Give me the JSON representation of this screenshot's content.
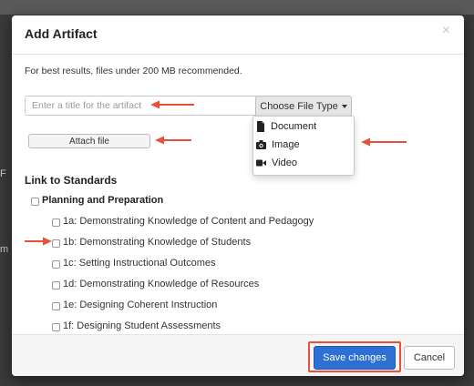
{
  "modal": {
    "title": "Add Artifact",
    "close_glyph": "×",
    "note": "For best results, files under 200 MB recommended."
  },
  "title_input": {
    "value": "",
    "placeholder": "Enter a title for the artifact"
  },
  "file_type": {
    "button_label": "Choose File Type",
    "options": [
      {
        "label": "Document",
        "icon": "document-icon"
      },
      {
        "label": "Image",
        "icon": "camera-icon"
      },
      {
        "label": "Video",
        "icon": "video-camera-icon"
      }
    ]
  },
  "attach": {
    "label": "Attach file"
  },
  "standards": {
    "section_title": "Link to Standards",
    "group": {
      "label": "Planning and Preparation",
      "items": [
        "1a: Demonstrating Knowledge of Content and Pedagogy",
        "1b: Demonstrating Knowledge of Students",
        "1c: Setting Instructional Outcomes",
        "1d: Demonstrating Knowledge of Resources",
        "1e: Designing Coherent Instruction",
        "1f: Designing Student Assessments"
      ]
    }
  },
  "footer": {
    "save_label": "Save changes",
    "cancel_label": "Cancel"
  },
  "colors": {
    "primary": "#2d6fd2",
    "annotation": "#e8503a"
  }
}
